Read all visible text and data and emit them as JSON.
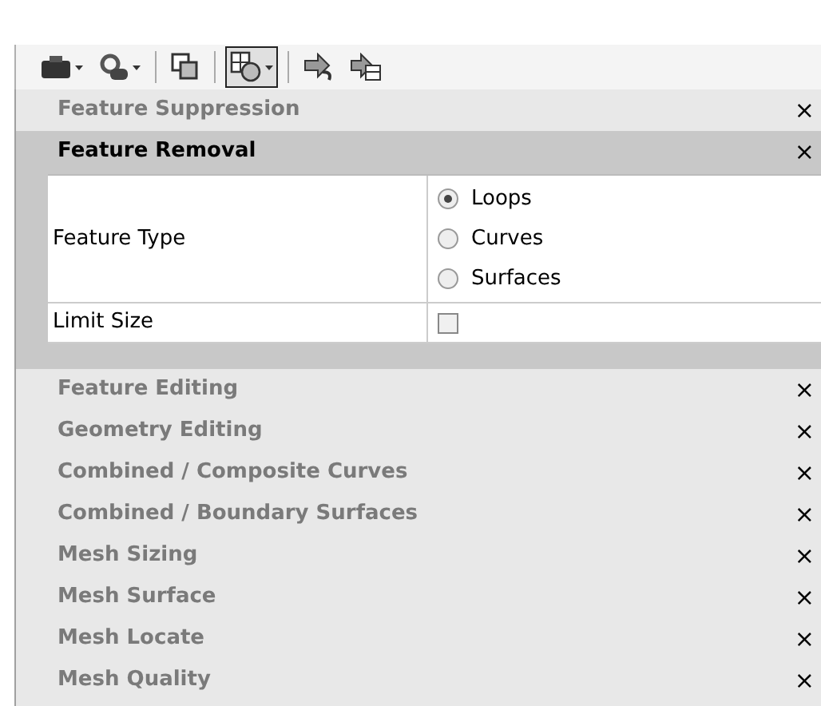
{
  "toolbar": [
    {
      "kind": "block",
      "dropdown": true,
      "selected": false
    },
    {
      "kind": "gear",
      "dropdown": true,
      "selected": false
    },
    {
      "kind": "separator"
    },
    {
      "kind": "copy",
      "dropdown": false,
      "selected": false
    },
    {
      "kind": "separator"
    },
    {
      "kind": "shapes",
      "dropdown": true,
      "selected": true
    },
    {
      "kind": "separator"
    },
    {
      "kind": "arrow-curve",
      "dropdown": false,
      "selected": false
    },
    {
      "kind": "arrow-table",
      "dropdown": false,
      "selected": false
    }
  ],
  "sections": [
    {
      "title": "Feature Suppression",
      "close": "×",
      "expanded": false
    },
    {
      "title": "Feature Removal",
      "close": "×",
      "expanded": true,
      "properties": [
        {
          "label": "Feature Type",
          "kind": "radio",
          "options": [
            {
              "label": "Loops",
              "selected": true
            },
            {
              "label": "Curves",
              "selected": false
            },
            {
              "label": "Surfaces",
              "selected": false
            }
          ]
        },
        {
          "label": "Limit Size",
          "kind": "checkbox",
          "checked": false
        }
      ]
    },
    {
      "title": "Feature Editing",
      "close": "×",
      "expanded": false
    },
    {
      "title": "Geometry Editing",
      "close": "×",
      "expanded": false
    },
    {
      "title": "Combined / Composite Curves",
      "close": "×",
      "expanded": false
    },
    {
      "title": "Combined / Boundary Surfaces",
      "close": "×",
      "expanded": false
    },
    {
      "title": "Mesh Sizing",
      "close": "×",
      "expanded": false
    },
    {
      "title": "Mesh Surface",
      "close": "×",
      "expanded": false
    },
    {
      "title": "Mesh Locate",
      "close": "×",
      "expanded": false
    },
    {
      "title": "Mesh Quality",
      "close": "×",
      "expanded": false
    }
  ]
}
